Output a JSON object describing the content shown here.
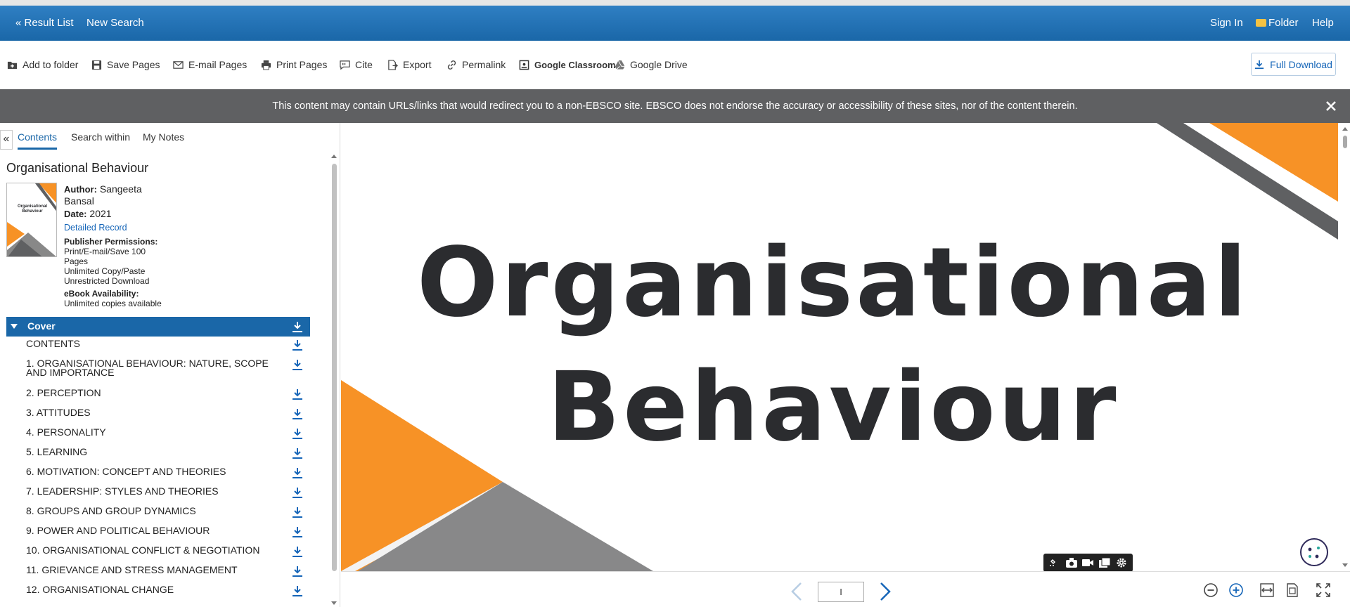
{
  "header": {
    "result_list": "« Result List",
    "new_search": "New Search",
    "sign_in": "Sign In",
    "folder": "Folder",
    "help": "Help"
  },
  "toolbar": {
    "add_to_folder": "Add to folder",
    "save_pages": "Save Pages",
    "email_pages": "E-mail Pages",
    "print_pages": "Print Pages",
    "cite": "Cite",
    "export": "Export",
    "permalink": "Permalink",
    "google_classroom": "Google Classroom",
    "google_drive": "Google Drive",
    "full_download": "Full Download"
  },
  "banner": {
    "text": "This content may contain URLs/links that would redirect you to a non-EBSCO site. EBSCO does not endorse the accuracy or accessibility of these sites, nor of the content therein."
  },
  "sidebar": {
    "collapse": "«",
    "tabs": [
      "Contents",
      "Search within",
      "My Notes"
    ],
    "book_title": "Organisational Behaviour",
    "thumb_title": "Organisational Behaviour",
    "author_label": "Author:",
    "author_value": "Sangeeta Bansal",
    "date_label": "Date:",
    "date_value": "2021",
    "detailed_record": "Detailed Record",
    "permissions_label": "Publisher Permissions:",
    "permissions_value": "Print/E-mail/Save 100 Pages",
    "copy_paste": "Unlimited Copy/Paste",
    "unrestricted": "Unrestricted Download",
    "availability_label": "eBook Availability:",
    "availability_value": "Unlimited copies available",
    "toc": [
      "Cover",
      "CONTENTS",
      "1. ORGANISATIONAL BEHAVIOUR: NATURE, SCOPE AND IMPORTANCE",
      "2. PERCEPTION",
      "3. ATTITUDES",
      "4. PERSONALITY",
      "5. LEARNING",
      "6. MOTIVATION: CONCEPT AND THEORIES",
      "7. LEADERSHIP: STYLES AND THEORIES",
      "8. GROUPS AND GROUP DYNAMICS",
      "9. POWER AND POLITICAL BEHAVIOUR",
      "10. ORGANISATIONAL CONFLICT & NEGOTIATION",
      "11. GRIEVANCE AND STRESS MANAGEMENT",
      "12. ORGANISATIONAL CHANGE"
    ]
  },
  "viewer": {
    "title_line1": "Organisational",
    "title_line2": "Behaviour",
    "page_value": "I"
  },
  "colors": {
    "brand_blue": "#1a67a8",
    "accent_orange": "#f79226",
    "dark_gray": "#5f6062",
    "title_text": "#2b2c2f"
  }
}
